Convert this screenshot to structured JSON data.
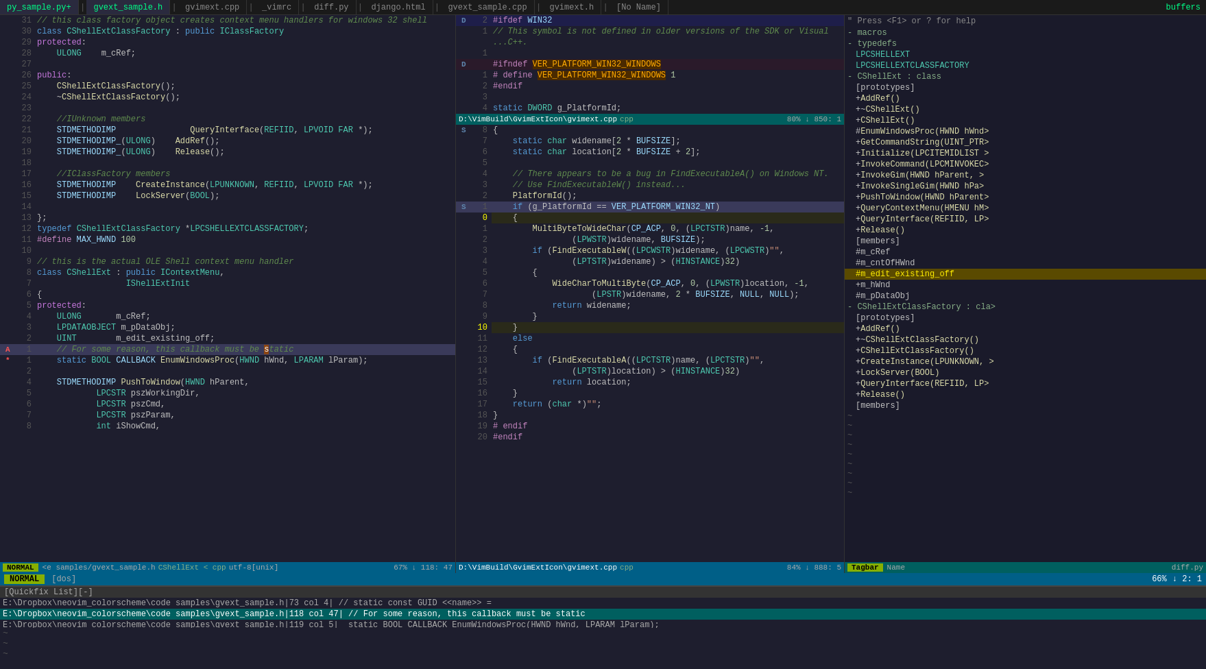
{
  "tabbar": {
    "tabs": [
      {
        "label": "py_sample.py+",
        "active": false,
        "color": "green"
      },
      {
        "label": "gvext_sample.h",
        "active": true,
        "color": "green"
      },
      {
        "label": "gvimext.cpp",
        "active": false
      },
      {
        "label": "_vimrc",
        "active": false
      },
      {
        "label": "diff.py",
        "active": false
      },
      {
        "label": "django.html",
        "active": false
      },
      {
        "label": "gvext_sample.cpp",
        "active": false
      },
      {
        "label": "gvimext.h",
        "active": false
      },
      {
        "label": "[No Name]",
        "active": false
      }
    ],
    "buffers_label": "buffers"
  },
  "panel_left": {
    "title": "gvext_sample.h",
    "lines": [
      {
        "num": "31",
        "marker": "",
        "content": "class CShellExtClassFactory : public IClassFactory",
        "classes": []
      },
      {
        "num": "30",
        "marker": "",
        "content": "// this class factory object creates context menu handlers for windows 32 shell",
        "classes": [
          "comment"
        ]
      },
      {
        "num": "29",
        "marker": "",
        "content": "protected:",
        "classes": [
          "kw"
        ]
      },
      {
        "num": "28",
        "marker": "",
        "content": "    ULONG    m_cRef;",
        "classes": []
      },
      {
        "num": "27",
        "marker": "",
        "content": "",
        "classes": []
      },
      {
        "num": "26",
        "marker": "",
        "content": "public:",
        "classes": [
          "kw"
        ]
      },
      {
        "num": "25",
        "marker": "",
        "content": "    CShellExtClassFactory();",
        "classes": []
      },
      {
        "num": "24",
        "marker": "",
        "content": "    ~CShellExtClassFactory();",
        "classes": []
      },
      {
        "num": "23",
        "marker": "",
        "content": "",
        "classes": []
      },
      {
        "num": "22",
        "marker": "",
        "content": "    //IUnknown members",
        "classes": [
          "comment"
        ]
      },
      {
        "num": "21",
        "marker": "",
        "content": "    STDMETHODIMP               QueryInterface(REFIID, LPVOID FAR *);",
        "classes": []
      },
      {
        "num": "20",
        "marker": "",
        "content": "    STDMETHODIMP_(ULONG)    AddRef();",
        "classes": []
      },
      {
        "num": "19",
        "marker": "",
        "content": "    STDMETHODIMP_(ULONG)    Release();",
        "classes": []
      },
      {
        "num": "18",
        "marker": "",
        "content": "",
        "classes": []
      },
      {
        "num": "17",
        "marker": "",
        "content": "    //IClassFactory members",
        "classes": [
          "comment"
        ]
      },
      {
        "num": "16",
        "marker": "",
        "content": "    STDMETHODIMP    CreateInstance(LPUNKNOWN, REFIID, LPVOID FAR *);",
        "classes": []
      },
      {
        "num": "15",
        "marker": "",
        "content": "    STDMETHODIMP    LockServer(BOOL);",
        "classes": []
      },
      {
        "num": "14",
        "marker": "",
        "content": "",
        "classes": []
      },
      {
        "num": "13",
        "marker": "",
        "content": "};",
        "classes": []
      },
      {
        "num": "12",
        "marker": "",
        "content": "typedef CShellExtClassFactory *LPCSHELLEXTCLASSFACTORY;",
        "classes": []
      },
      {
        "num": "11",
        "marker": "",
        "content": "#define MAX_HWND 100",
        "classes": [
          "pp"
        ]
      },
      {
        "num": "10",
        "marker": "",
        "content": "",
        "classes": []
      },
      {
        "num": "9",
        "marker": "",
        "content": "// this is the actual OLE Shell context menu handler",
        "classes": [
          "comment"
        ]
      },
      {
        "num": "8",
        "marker": "",
        "content": "class CShellExt : public IContextMenu,",
        "classes": []
      },
      {
        "num": "7",
        "marker": "",
        "content": "                  IShellExtInit",
        "classes": []
      },
      {
        "num": "6",
        "marker": "",
        "content": "{",
        "classes": []
      },
      {
        "num": "5",
        "marker": "",
        "content": "protected:",
        "classes": [
          "kw"
        ]
      },
      {
        "num": "4",
        "marker": "",
        "content": "    ULONG       m_cRef;",
        "classes": []
      },
      {
        "num": "3",
        "marker": "",
        "content": "    LPDATAOBJECT m_pDataObj;",
        "classes": []
      },
      {
        "num": "2",
        "marker": "",
        "content": "    UINT        m_edit_existing_off;",
        "classes": []
      },
      {
        "num": "1",
        "marker": "A",
        "content": "    // For some reason, this callback must be static",
        "classes": [
          "comment",
          "cursor-line"
        ],
        "marker_color": "red"
      },
      {
        "num": "1",
        "marker": "*",
        "content": "    static BOOL CALLBACK EnumWindowsProc(HWND hWnd, LPARAM lParam);",
        "classes": [],
        "marker_color": "red"
      },
      {
        "num": "2",
        "marker": "",
        "content": "",
        "classes": []
      },
      {
        "num": "4",
        "marker": "",
        "content": "    STDMETHODIMP PushToWindow(HWND hParent,",
        "classes": []
      },
      {
        "num": "5",
        "marker": "",
        "content": "            LPCSTR pszWorkingDir,",
        "classes": []
      },
      {
        "num": "6",
        "marker": "",
        "content": "            LPCSTR pszCmd,",
        "classes": []
      },
      {
        "num": "7",
        "marker": "",
        "content": "            LPCSTR pszParam,",
        "classes": []
      },
      {
        "num": "8",
        "marker": "",
        "content": "            int iShowCmd,",
        "classes": []
      }
    ],
    "statusbar": {
      "mode": "NORMAL",
      "file": "<e samples/gvext_sample.h",
      "class": "CShellExt < cpp",
      "encoding": "utf-8[unix]",
      "percent": "67%",
      "line": "118",
      "col": "47"
    }
  },
  "panel_mid": {
    "title": "D:\\VimBuild\\GvimExtIcon\\gvimext.cpp",
    "lines_top": [
      {
        "num": "2",
        "marker": "D",
        "content": "#ifdef WIN32",
        "classes": [
          "pp"
        ]
      },
      {
        "num": "1",
        "marker": "",
        "content": "// This symbol is not defined in older versions of the SDK or Visual",
        "classes": [
          "comment"
        ]
      },
      {
        "num": "",
        "marker": "",
        "content": "...C++.",
        "classes": [
          "comment"
        ]
      },
      {
        "num": "1",
        "marker": "",
        "content": "",
        "classes": []
      },
      {
        "num": "D",
        "marker": "D",
        "content": "#ifndef VER_PLATFORM_WIN32_WINDOWS",
        "classes": [
          "pp",
          "diff-marker"
        ]
      },
      {
        "num": "1",
        "marker": "",
        "content": "# define VER_PLATFORM_WIN32_WINDOWS 1",
        "classes": [
          "pp"
        ]
      },
      {
        "num": "2",
        "marker": "",
        "content": "#endif",
        "classes": [
          "pp"
        ]
      },
      {
        "num": "3",
        "marker": "",
        "content": "",
        "classes": []
      },
      {
        "num": "4",
        "marker": "",
        "content": "static DWORD g_PlatformId;",
        "classes": []
      }
    ],
    "statusbar_top": {
      "file": "D:\\VimBuild\\GvimExtIcon\\gvimext.cpp",
      "type": "cpp",
      "percent": "80%",
      "line": "850",
      "col": "1"
    },
    "lines_bot": [
      {
        "num": "8",
        "marker": "S",
        "content": "{",
        "classes": []
      },
      {
        "num": "7",
        "marker": "",
        "content": "    static char widename[2 * BUFSIZE];",
        "classes": []
      },
      {
        "num": "6",
        "marker": "",
        "content": "    static char location[2 * BUFSIZE + 2];",
        "classes": []
      },
      {
        "num": "5",
        "marker": "",
        "content": "",
        "classes": []
      },
      {
        "num": "4",
        "marker": "",
        "content": "    // There appears to be a bug in FindExecutableA() on Windows NT.",
        "classes": [
          "comment"
        ]
      },
      {
        "num": "3",
        "marker": "",
        "content": "    // Use FindExecutableW() instead...",
        "classes": [
          "comment"
        ]
      },
      {
        "num": "2",
        "marker": "",
        "content": "    PlatformId();",
        "classes": []
      },
      {
        "num": "1",
        "marker": "S",
        "content": "    if (g_PlatformId == VER_PLATFORM_WIN32_NT)",
        "classes": [
          "cursor-line"
        ]
      },
      {
        "num": "0",
        "marker": "",
        "content": "    {",
        "classes": [
          "lnum-yellow"
        ]
      },
      {
        "num": "1",
        "marker": "",
        "content": "        MultiByteToWideChar(CP_ACP, 0, (LPCTSTR)name, -1,",
        "classes": []
      },
      {
        "num": "2",
        "marker": "",
        "content": "                (LPWSTR)widename, BUFSIZE);",
        "classes": []
      },
      {
        "num": "3",
        "marker": "",
        "content": "        if (FindExecutableW((LPCWSTR)widename, (LPCWSTR)\"\",",
        "classes": []
      },
      {
        "num": "4",
        "marker": "",
        "content": "                (LPTSTR)widename) > (HINSTANCE)32)",
        "classes": []
      },
      {
        "num": "5",
        "marker": "",
        "content": "        {",
        "classes": []
      },
      {
        "num": "6",
        "marker": "",
        "content": "            WideCharToMultiByte(CP_ACP, 0, (LPWSTR)location, -1,",
        "classes": []
      },
      {
        "num": "7",
        "marker": "",
        "content": "                    (LPSTR)widename, 2 * BUFSIZE, NULL, NULL);",
        "classes": []
      },
      {
        "num": "8",
        "marker": "",
        "content": "            return widename;",
        "classes": []
      },
      {
        "num": "9",
        "marker": "",
        "content": "        }",
        "classes": []
      },
      {
        "num": "10",
        "marker": "",
        "content": "    }",
        "classes": [
          "lnum-yellow"
        ]
      },
      {
        "num": "11",
        "marker": "",
        "content": "    else",
        "classes": [
          "kw"
        ]
      },
      {
        "num": "12",
        "marker": "",
        "content": "    {",
        "classes": []
      },
      {
        "num": "13",
        "marker": "",
        "content": "        if (FindExecutableA((LPCTSTR)name, (LPCTSTR)\"\",",
        "classes": []
      },
      {
        "num": "14",
        "marker": "",
        "content": "                (LPTSTR)location) > (HINSTANCE)32)",
        "classes": []
      },
      {
        "num": "15",
        "marker": "",
        "content": "            return location;",
        "classes": []
      },
      {
        "num": "16",
        "marker": "",
        "content": "    }",
        "classes": []
      },
      {
        "num": "17",
        "marker": "",
        "content": "    return (char *)\"\";",
        "classes": []
      },
      {
        "num": "18",
        "marker": "",
        "content": "}",
        "classes": []
      },
      {
        "num": "19",
        "marker": "",
        "content": "# endif",
        "classes": [
          "pp"
        ]
      },
      {
        "num": "20",
        "marker": "",
        "content": "#endif",
        "classes": [
          "pp"
        ]
      }
    ],
    "statusbar_bot": {
      "file": "D:\\VimBuild\\GvimExtIcon\\gvimext.cpp",
      "type": "cpp",
      "percent": "84%",
      "line": "888",
      "col": "5"
    }
  },
  "panel_right": {
    "hint": "\" Press <F1> or ? for help",
    "sections": [
      {
        "label": "- macros",
        "items": []
      },
      {
        "label": "- typedefs",
        "items": [
          {
            "text": "LPCSHELLEXT"
          },
          {
            "text": "LPCSHELLEXTCLASSFACTORY"
          }
        ]
      },
      {
        "label": "- CShellExt : class",
        "items": [
          {
            "text": "[prototypes]"
          },
          {
            "text": "+AddRef()"
          },
          {
            "text": "+~CShellExt()"
          },
          {
            "text": "+CShellExt()"
          },
          {
            "text": "#EnumWindowsProc(HWND hWnd>"
          },
          {
            "text": "+GetCommandString(UINT_PTR>"
          },
          {
            "text": "+Initialize(LPCITEMIDLIST >"
          },
          {
            "text": "+InvokeCommand(LPCMINVOKEC>"
          },
          {
            "text": "+InvokeGim(HWND hParent, >"
          },
          {
            "text": "+InvokeSingleGim(HWND hPa>"
          },
          {
            "text": "+PushToWindow(HWND hParent>"
          },
          {
            "text": "+QueryContextMenu(HMENU hM>"
          },
          {
            "text": "+QueryInterface(REFIID, LP>"
          },
          {
            "text": "+Release()"
          },
          {
            "text": "  [members]"
          },
          {
            "text": "#m_cRef"
          },
          {
            "text": "#m_cntOfHWnd"
          },
          {
            "text": "#m_edit_existing_off",
            "selected": true
          },
          {
            "text": "+m_hWnd"
          },
          {
            "text": "#m_pDataObj"
          }
        ]
      },
      {
        "label": "- CShellExtClassFactory : cla>",
        "items": [
          {
            "text": "[prototypes]"
          },
          {
            "text": "+AddRef()"
          },
          {
            "text": "+~CShellExtClassFactory()"
          },
          {
            "text": "+CShellExtClassFactory()"
          },
          {
            "text": "+CreateInstance(LPUNKNOWN, >"
          },
          {
            "text": "+LockServer(BOOL)"
          },
          {
            "text": "+QueryInterface(REFIID, LP>"
          },
          {
            "text": "+Release()"
          },
          {
            "text": "  [members]"
          }
        ]
      }
    ],
    "statusbar": {
      "label": "Tagbar",
      "sort": "Name",
      "type": "diff.py"
    }
  },
  "bottom_statusbar": {
    "mode": "NORMAL",
    "encoding": "[dos]",
    "percent": "66%",
    "line": "2",
    "col": "1"
  },
  "quickfix": {
    "title": "[Quickfix List][-]",
    "lines": [
      {
        "text": "E:\\Dropbox\\neovim_colorscheme\\code samples\\gvext_sample.h|73 col 4| // static const GUID <<name>> =",
        "active": false
      },
      {
        "text": "E:\\Dropbox\\neovim_colorscheme\\code samples\\gvext_sample.h|118 col 47| // For some reason, this callback must be static",
        "active": true
      },
      {
        "text": "E:\\Dropbox\\neovim_colorscheme\\code samples\\gvext_sample.h|119 col 5| static BOOL CALLBACK EnumWindowsProc(HWND hWnd, LPARAM lParam);",
        "active": false
      }
    ]
  },
  "tilde_lines": [
    "~",
    "~",
    "~",
    "~",
    "~",
    "~",
    "~",
    "~",
    "~",
    "~"
  ]
}
